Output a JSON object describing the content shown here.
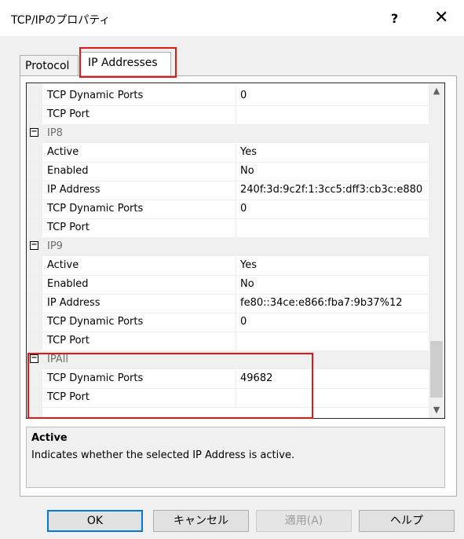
{
  "window": {
    "title": "TCP/IPのプロパティ",
    "help_glyph": "?",
    "close_glyph": "✕"
  },
  "tabs": [
    {
      "label": "Protocol"
    },
    {
      "label": "IP Addresses"
    }
  ],
  "grid": {
    "rows": [
      {
        "type": "prop",
        "name": "TCP Dynamic Ports",
        "value": "0"
      },
      {
        "type": "prop",
        "name": "TCP Port",
        "value": ""
      },
      {
        "type": "category",
        "name": "IP8",
        "toggle": "−"
      },
      {
        "type": "prop",
        "name": "Active",
        "value": "Yes"
      },
      {
        "type": "prop",
        "name": "Enabled",
        "value": "No"
      },
      {
        "type": "prop",
        "name": "IP Address",
        "value": "240f:3d:9c2f:1:3cc5:dff3:cb3c:e880"
      },
      {
        "type": "prop",
        "name": "TCP Dynamic Ports",
        "value": "0"
      },
      {
        "type": "prop",
        "name": "TCP Port",
        "value": ""
      },
      {
        "type": "category",
        "name": "IP9",
        "toggle": "−"
      },
      {
        "type": "prop",
        "name": "Active",
        "value": "Yes"
      },
      {
        "type": "prop",
        "name": "Enabled",
        "value": "No"
      },
      {
        "type": "prop",
        "name": "IP Address",
        "value": "fe80::34ce:e866:fba7:9b37%12"
      },
      {
        "type": "prop",
        "name": "TCP Dynamic Ports",
        "value": "0"
      },
      {
        "type": "prop",
        "name": "TCP Port",
        "value": ""
      },
      {
        "type": "category",
        "name": "IPAll",
        "toggle": "−"
      },
      {
        "type": "prop",
        "name": "TCP Dynamic Ports",
        "value": "49682"
      },
      {
        "type": "prop",
        "name": "TCP Port",
        "value": ""
      }
    ],
    "scroll_up": "▲",
    "scroll_down": "▼"
  },
  "description": {
    "title": "Active",
    "text": "Indicates whether the selected IP Address is active."
  },
  "buttons": {
    "ok": "OK",
    "cancel": "キャンセル",
    "apply": "適用(A)",
    "help": "ヘルプ"
  },
  "colors": {
    "highlight": "#e51616",
    "focus": "#0078d7"
  }
}
